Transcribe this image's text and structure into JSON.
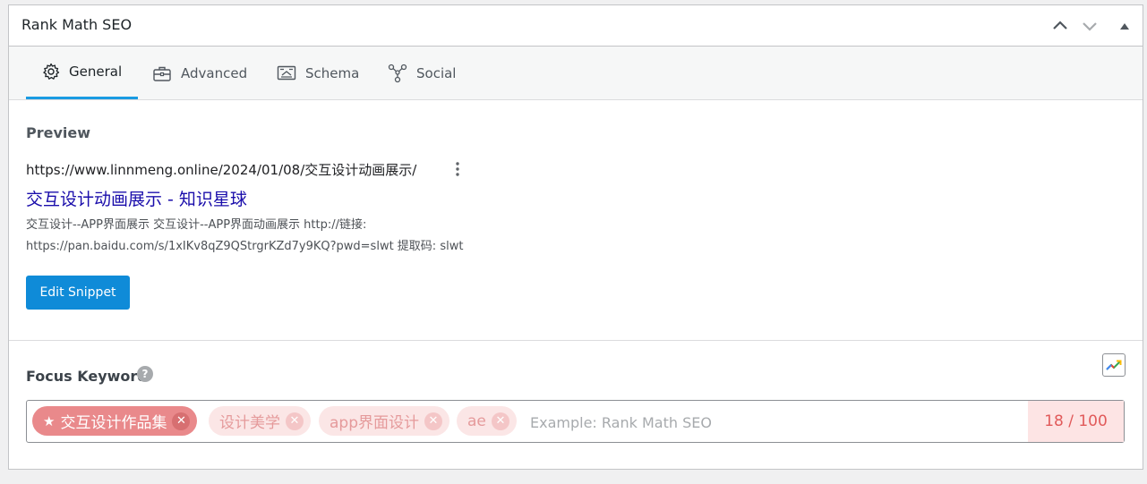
{
  "panel": {
    "title": "Rank Math SEO"
  },
  "tabs": [
    {
      "label": "General",
      "icon": "gear-icon",
      "active": true
    },
    {
      "label": "Advanced",
      "icon": "toolbox-icon",
      "active": false
    },
    {
      "label": "Schema",
      "icon": "schema-icon",
      "active": false
    },
    {
      "label": "Social",
      "icon": "social-share-icon",
      "active": false
    }
  ],
  "preview": {
    "label": "Preview",
    "url": "https://www.linnmeng.online/2024/01/08/交互设计动画展示/",
    "title": "交互设计动画展示 - 知识星球",
    "description_line1": "交互设计--APP界面展示 交互设计--APP界面动画展示 http://链接:",
    "description_line2": "https://pan.baidu.com/s/1xIKv8qZ9QStrgrKZd7y9KQ?pwd=slwt 提取码: slwt",
    "edit_button": "Edit Snippet"
  },
  "focus_keyword": {
    "label": "Focus Keyword",
    "help": "?",
    "keywords": [
      "交互设计作品集",
      "设计美学",
      "app界面设计",
      "ae"
    ],
    "placeholder": "Example: Rank Math SEO",
    "score": "18 / 100"
  },
  "colors": {
    "accent": "#1a9be2",
    "button": "#0f8bd8",
    "link": "#1a0dab",
    "score_bad": "#e15a5a"
  }
}
